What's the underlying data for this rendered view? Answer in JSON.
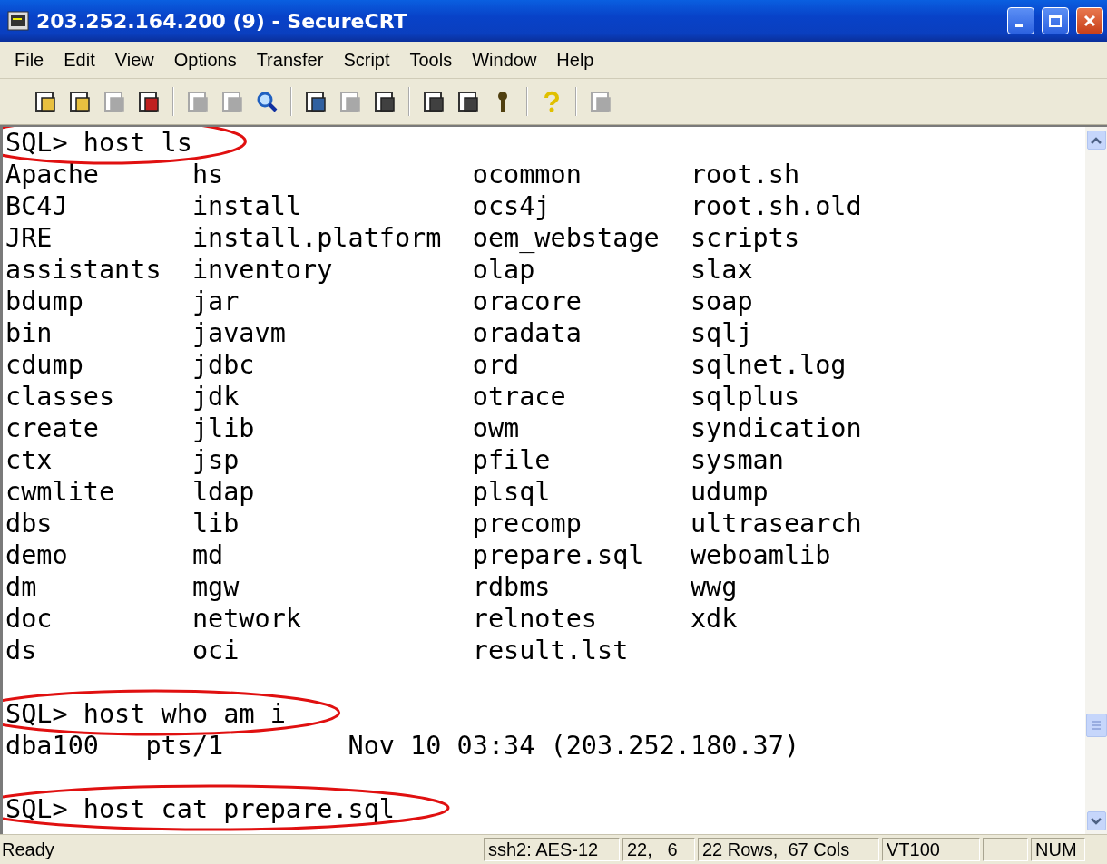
{
  "window": {
    "title": "203.252.164.200 (9) - SecureCRT"
  },
  "menu": [
    "File",
    "Edit",
    "View",
    "Options",
    "Transfer",
    "Script",
    "Tools",
    "Window",
    "Help"
  ],
  "toolbar_groups": [
    [
      {
        "disabled": false
      },
      {
        "disabled": false
      },
      {
        "disabled": true
      },
      {
        "disabled": false
      }
    ],
    [
      {
        "disabled": true
      },
      {
        "disabled": true
      },
      {
        "disabled": false
      }
    ],
    [
      {
        "disabled": false
      },
      {
        "disabled": true
      },
      {
        "disabled": false
      }
    ],
    [
      {
        "disabled": false
      },
      {
        "disabled": false
      },
      {
        "disabled": false
      }
    ],
    [
      {
        "disabled": false
      }
    ],
    [
      {
        "disabled": true
      }
    ]
  ],
  "terminal": {
    "lines": [
      {
        "kind": "prompt",
        "text": "SQL> host ls",
        "circled": true
      },
      {
        "kind": "columns",
        "cells": [
          "Apache",
          "hs",
          "ocommon",
          "root.sh"
        ]
      },
      {
        "kind": "columns",
        "cells": [
          "BC4J",
          "install",
          "ocs4j",
          "root.sh.old"
        ]
      },
      {
        "kind": "columns",
        "cells": [
          "JRE",
          "install.platform",
          "oem_webstage",
          "scripts"
        ]
      },
      {
        "kind": "columns",
        "cells": [
          "assistants",
          "inventory",
          "olap",
          "slax"
        ]
      },
      {
        "kind": "columns",
        "cells": [
          "bdump",
          "jar",
          "oracore",
          "soap"
        ]
      },
      {
        "kind": "columns",
        "cells": [
          "bin",
          "javavm",
          "oradata",
          "sqlj"
        ]
      },
      {
        "kind": "columns",
        "cells": [
          "cdump",
          "jdbc",
          "ord",
          "sqlnet.log"
        ]
      },
      {
        "kind": "columns",
        "cells": [
          "classes",
          "jdk",
          "otrace",
          "sqlplus"
        ]
      },
      {
        "kind": "columns",
        "cells": [
          "create",
          "jlib",
          "owm",
          "syndication"
        ]
      },
      {
        "kind": "columns",
        "cells": [
          "ctx",
          "jsp",
          "pfile",
          "sysman"
        ]
      },
      {
        "kind": "columns",
        "cells": [
          "cwmlite",
          "ldap",
          "plsql",
          "udump"
        ]
      },
      {
        "kind": "columns",
        "cells": [
          "dbs",
          "lib",
          "precomp",
          "ultrasearch"
        ]
      },
      {
        "kind": "columns",
        "cells": [
          "demo",
          "md",
          "prepare.sql",
          "weboamlib"
        ]
      },
      {
        "kind": "columns",
        "cells": [
          "dm",
          "mgw",
          "rdbms",
          "wwg"
        ]
      },
      {
        "kind": "columns",
        "cells": [
          "doc",
          "network",
          "relnotes",
          "xdk"
        ]
      },
      {
        "kind": "columns",
        "cells": [
          "ds",
          "oci",
          "result.lst"
        ]
      },
      {
        "kind": "blank"
      },
      {
        "kind": "prompt",
        "text": "SQL> host who am i",
        "circled": true
      },
      {
        "kind": "output",
        "text": "dba100   pts/1        Nov 10 03:34 (203.252.180.37)"
      },
      {
        "kind": "blank"
      },
      {
        "kind": "prompt",
        "text": "SQL> host cat prepare.sql",
        "circled": true
      }
    ]
  },
  "status_bar": {
    "message": "Ready",
    "panes": [
      "ssh2: AES-12",
      "22,   6",
      "22 Rows,  67 Cols",
      "VT100",
      "NUM"
    ]
  }
}
